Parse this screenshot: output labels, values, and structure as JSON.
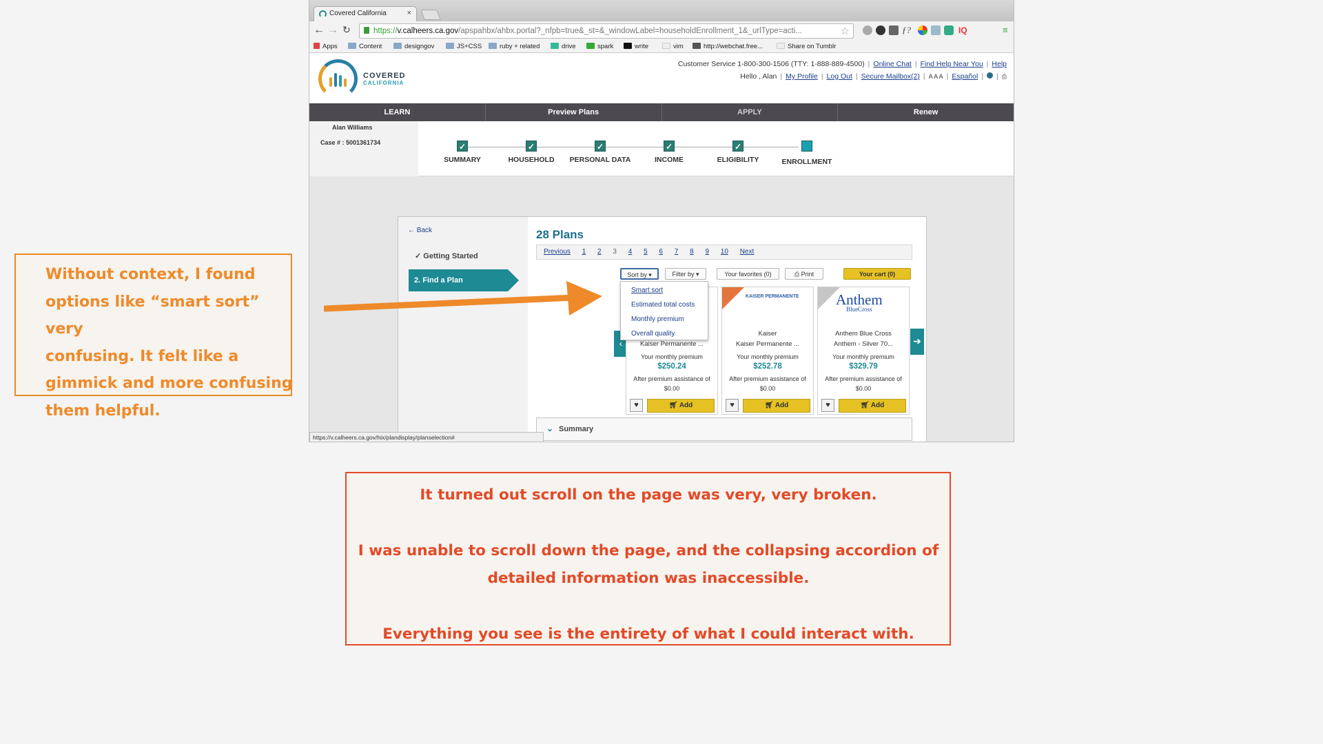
{
  "browser": {
    "tab_title": "Covered California",
    "tab_close": "×",
    "url_scheme": "https://",
    "url_host": "v.calheers.ca.gov",
    "url_path": "/apspahbx/ahbx.portal?_nfpb=true&_st=&_windowLabel=householdEnrollment_1&_urlType=acti...",
    "bookmarks": [
      "Apps",
      "Content",
      "designgov",
      "JS+CSS",
      "ruby + related",
      "drive",
      "spark",
      "write",
      "vim",
      "http://webchat.free...",
      "Share on Tumblr"
    ],
    "status_url": "https://v.calheers.ca.gov/hix/plandisplay/planselection#"
  },
  "site": {
    "logo_line1": "COVERED",
    "logo_line2": "CALIFORNIA",
    "customer_service": "Customer Service 1-800-300-1506 (TTY: 1-888-889-4500)",
    "links_top": [
      "Online Chat",
      "Find Help Near You",
      "Help"
    ],
    "greeting": "Hello , Alan",
    "links_second": [
      "My Profile",
      "Log Out",
      "Secure Mailbox(2)"
    ],
    "font_sizes": "A A A",
    "espanol": "Español",
    "nav": [
      "LEARN",
      "Preview Plans",
      "APPLY",
      "Renew"
    ],
    "user_name": "Alan Williams",
    "case_number": "Case # : 5001361734",
    "steps": [
      "SUMMARY",
      "HOUSEHOLD",
      "PERSONAL DATA",
      "INCOME",
      "ELIGIBILITY",
      "ENROLLMENT"
    ]
  },
  "plans": {
    "back": "← Back",
    "getting_started": "Getting Started",
    "find_a_plan": "2. Find a Plan",
    "title": "28 Plans",
    "pager": {
      "previous": "Previous",
      "pages": [
        "1",
        "2",
        "3",
        "4",
        "5",
        "6",
        "7",
        "8",
        "9",
        "10"
      ],
      "current": "3",
      "next": "Next"
    },
    "sort_by": "Sort by ▾",
    "filter_by": "Filter by ▾",
    "favorites": "Your favorites (0)",
    "print": "Print",
    "cart": "Your cart (0)",
    "sort_options": [
      "Smart sort",
      "Estimated total costs",
      "Monthly premium",
      "Overall quality"
    ],
    "premium_label": "Your monthly premium",
    "assistance_label": "After premium assistance of",
    "add_label": "Add",
    "cards": [
      {
        "carrier": "",
        "name": "Kaiser Permanente ...",
        "price": "$250.24",
        "assistance": "$0.00"
      },
      {
        "carrier": "Kaiser",
        "name": "Kaiser Permanente ...",
        "price": "$252.78",
        "assistance": "$0.00",
        "logo": "KAISER PERMANENTE"
      },
      {
        "carrier": "Anthem Blue Cross",
        "name": "Anthem - Silver 70...",
        "price": "$329.79",
        "assistance": "$0.00",
        "logo": "Anthem",
        "logo_sub": "BlueCross"
      }
    ],
    "summary": "Summary"
  },
  "annotations": {
    "left_lines": [
      "Without context, I found",
      "options like “smart sort” very",
      "confusing. It felt like a",
      "gimmick and more confusing",
      "them helpful."
    ],
    "bottom_lines": [
      "It turned out scroll on the page was very, very broken.",
      "I was unable to scroll down the page, and the collapsing accordion of",
      "detailed information was inaccessible.",
      "Everything you see is the entirety of what I could interact with."
    ]
  },
  "colors": {
    "orange_note": "#ed8b2c",
    "red_note": "#e24a28",
    "teal": "#1d8a94",
    "nav_dark": "#4c4a4f",
    "cart_yellow": "#e6c124"
  }
}
